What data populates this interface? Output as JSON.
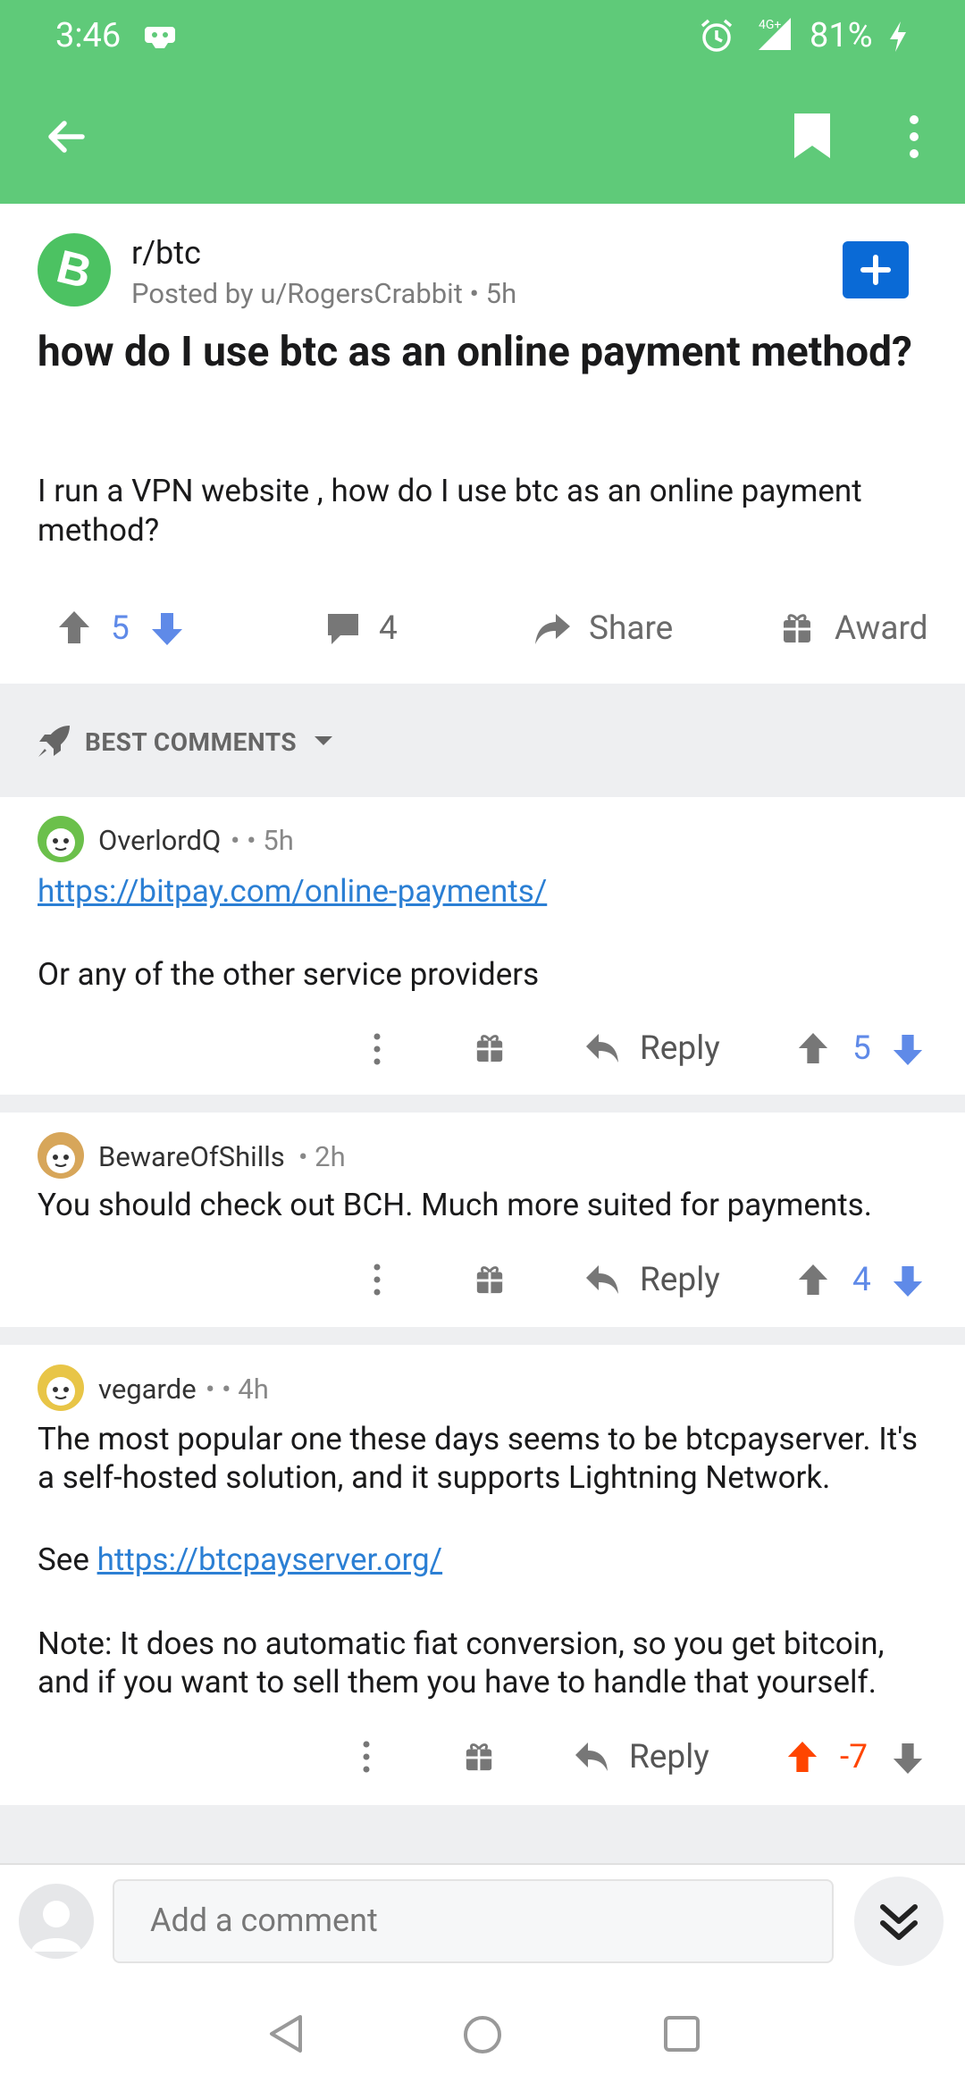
{
  "status_bar": {
    "time": "3:46",
    "network": "4G+",
    "battery": "81%"
  },
  "toolbar": {
    "back_icon": "arrow-left-icon",
    "bookmark_icon": "bookmark-icon",
    "more_icon": "more-vert-icon"
  },
  "post": {
    "subreddit": "r/btc",
    "posted_by": "Posted by u/RogersCrabbit • 5h",
    "title": "how do I use btc as an online payment method?",
    "body": "I run a VPN website  , how do I use btc as an online payment method?",
    "score": "5",
    "comments_count": "4",
    "share_label": "Share",
    "award_label": "Award"
  },
  "sort": {
    "label": "BEST COMMENTS"
  },
  "comments": [
    {
      "username": "OverlordQ",
      "meta": "• • 5h",
      "link": "https://bitpay.com/online-payments/",
      "text": "Or any of the other service providers",
      "reply_label": "Reply",
      "score": "5"
    },
    {
      "username": "BewareOfShills",
      "meta": "• 2h",
      "text": "You should check out BCH. Much more suited for payments.",
      "reply_label": "Reply",
      "score": "4"
    },
    {
      "username": "vegarde",
      "meta": "• • 4h",
      "text1": "The most popular one these days seems to be btcpayserver. It's a self-hosted solution, and it supports Lightning Network.",
      "see_label": "See ",
      "link": "https://btcpayserver.org/",
      "text2": "Note: It does no automatic fiat conversion, so you get bitcoin, and if you want to sell them you have to handle that yourself.",
      "reply_label": "Reply",
      "score": "-7"
    }
  ],
  "composer": {
    "placeholder": "Add a comment"
  },
  "colors": {
    "header": "#5fca79",
    "upvote_active": "#ff4500",
    "vote_blue": "#5f8ae8",
    "join_button": "#0a6ad6"
  }
}
